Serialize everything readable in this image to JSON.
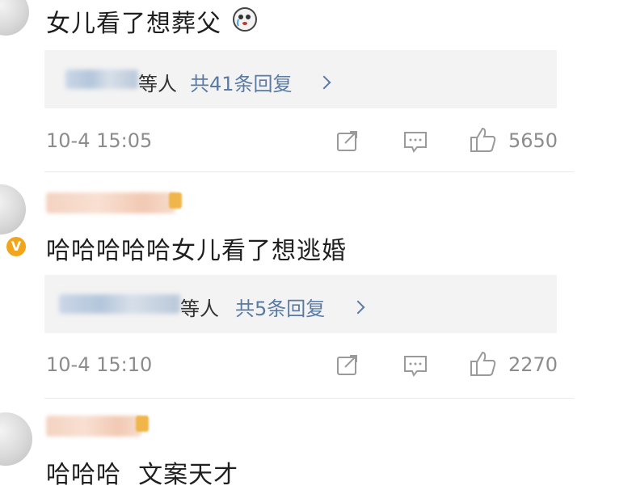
{
  "comments": [
    {
      "text": "女儿看了想葬父",
      "emoji_icon": "crying-face-icon",
      "reply_who": "等人",
      "reply_link": "共41条回复",
      "time": "10-4 15:05",
      "likes": "5650"
    },
    {
      "text": "哈哈哈哈哈女儿看了想逃婚",
      "badge_icon": "verified-v-icon",
      "badge_text": "V",
      "reply_who": "等人",
      "reply_link": "共5条回复",
      "time": "10-4 15:10",
      "likes": "2270"
    },
    {
      "text": "哈哈哈  文案天才"
    }
  ],
  "colors": {
    "link": "#5a7aa3",
    "meta": "#8c8c8c",
    "reply_bg": "#f3f3f3"
  }
}
